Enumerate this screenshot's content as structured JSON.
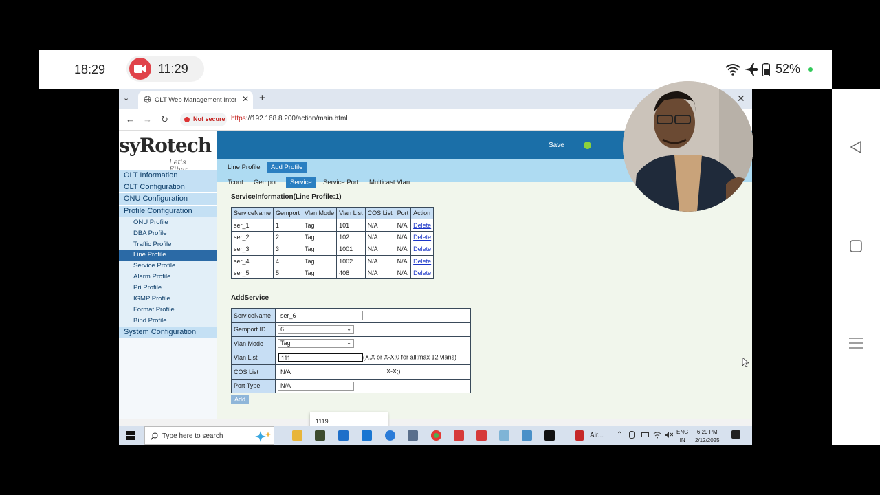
{
  "phone": {
    "clock": "18:29",
    "recording_time": "11:29",
    "battery": "52%"
  },
  "browser": {
    "tab_title": "OLT Web Management Interface",
    "url_scheme": "https",
    "url_rest": "://192.168.8.200/action/main.html",
    "security_label": "Not secure"
  },
  "app": {
    "logo": "syRotech",
    "logo_tagline": "Let's Fiber......",
    "save_label": "Save"
  },
  "sidebar": {
    "items": [
      {
        "label": "OLT Information"
      },
      {
        "label": "OLT Configuration"
      },
      {
        "label": "ONU Configuration"
      },
      {
        "label": "Profile Configuration"
      }
    ],
    "sub_items": [
      {
        "label": "ONU Profile"
      },
      {
        "label": "DBA Profile"
      },
      {
        "label": "Traffic Profile"
      },
      {
        "label": "Line Profile"
      },
      {
        "label": "Service Profile"
      },
      {
        "label": "Alarm Profile"
      },
      {
        "label": "Pri Profile"
      },
      {
        "label": "IGMP Profile"
      },
      {
        "label": "Format Profile"
      },
      {
        "label": "Bind Profile"
      }
    ],
    "last_item": "System Configuration"
  },
  "profile_tabs": [
    "Line Profile",
    "Add Profile"
  ],
  "sub_tabs": [
    "Tcont",
    "Gemport",
    "Service",
    "Service Port",
    "Multicast Vlan"
  ],
  "service_info": {
    "title": "ServiceInformation(Line Profile:1)",
    "columns": [
      "ServiceName",
      "Gemport",
      "Vlan Mode",
      "Vlan List",
      "COS List",
      "Port",
      "Action"
    ],
    "rows": [
      [
        "ser_1",
        "1",
        "Tag",
        "101",
        "N/A",
        "N/A",
        "Delete"
      ],
      [
        "ser_2",
        "2",
        "Tag",
        "102",
        "N/A",
        "N/A",
        "Delete"
      ],
      [
        "ser_3",
        "3",
        "Tag",
        "1001",
        "N/A",
        "N/A",
        "Delete"
      ],
      [
        "ser_4",
        "4",
        "Tag",
        "1002",
        "N/A",
        "N/A",
        "Delete"
      ],
      [
        "ser_5",
        "5",
        "Tag",
        "408",
        "N/A",
        "N/A",
        "Delete"
      ]
    ]
  },
  "add_service": {
    "title": "AddService",
    "service_name_label": "ServiceName",
    "service_name_value": "ser_6",
    "gemport_label": "Gemport ID",
    "gemport_value": "6",
    "vlan_mode_label": "Vlan Mode",
    "vlan_mode_value": "Tag",
    "vlan_list_label": "Vlan List",
    "vlan_list_value": "111",
    "vlan_list_hint": "(X,X or X-X;0 for all;max 12 vlans)",
    "cos_list_label": "COS List",
    "cos_list_value": "N/A",
    "cos_list_hint": "X-X;)",
    "port_type_label": "Port Type",
    "port_type_value": "N/A",
    "add_button": "Add",
    "autocomplete_suggestion": "1119"
  },
  "taskbar": {
    "search_placeholder": "Type here to search",
    "air_label": "Air...",
    "lang_line1": "ENG",
    "lang_line2": "IN",
    "time": "6:29 PM",
    "date": "2/12/2025"
  },
  "colors": {
    "banner": "#1b6fa8",
    "sidebar_active": "#2b6aa6",
    "table_header": "#c7def4",
    "link": "#1a35c8"
  }
}
